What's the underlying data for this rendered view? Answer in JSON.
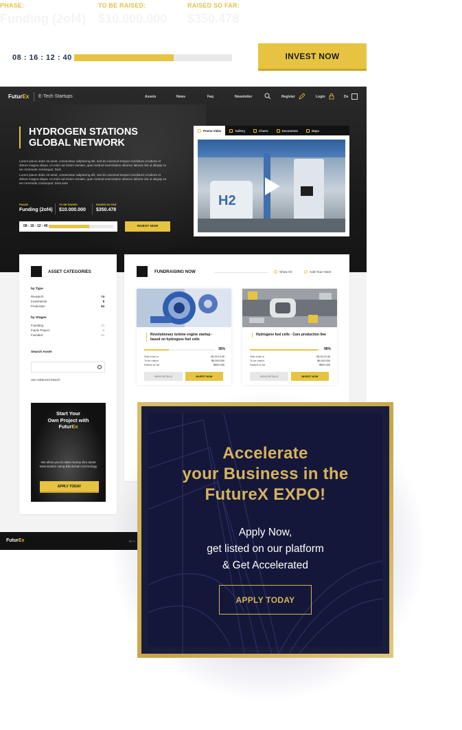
{
  "top": {
    "phase_label": "PHASE:",
    "to_be_raised_label": "TO BE RAISED:",
    "raised_so_far_label": "RAISED SO FAR:",
    "phase_value": "Funding (2of4)",
    "to_be_raised_value": "$10.000.000",
    "raised_value": "$350.478",
    "timer": "08 : 16 : 12 : 40",
    "progress": 0.63,
    "invest_label": "INVEST NOW"
  },
  "nav": {
    "logo_main": "Futur",
    "logo_accent": "Ex",
    "site_name": "E-Tech Startups",
    "items": [
      "Assets",
      "News",
      "Faq",
      "Newsletter"
    ],
    "register": "Register",
    "login": "Login",
    "lang": "De"
  },
  "hero": {
    "title": "HYDROGEN STATIONS GLOBAL NETWORK",
    "paragraph_1": "Lorem ipsum dolor sit amet, consectetur adipiscing elit, sed do eiusmod tempor incididunt ut labore et dolore magna aliqua. Ut enim ad minim veniam, quis nostrud exercitation ullamco laboris nisi ut aliquip ex ea commodo consequat. Duis",
    "paragraph_2": "Lorem ipsum dolor sit amet, consectetur adipiscing elit, sed do eiusmod tempor incididunt ut labore et dolore magna aliqua. Ut enim ad minim veniam, quis nostrud exercitation ullamco laboris nisi ut aliquip ex ea commodo consequat. Duis aute",
    "phase_label": "PHASE",
    "phase_value": "Funding (2of4)",
    "to_be_raised_label": "TO BE RAISED",
    "to_be_raised_value": "$10.000.000",
    "raised_label": "RAISED SO FAR",
    "raised_value": "$350.478",
    "timer": "08 : 16 : 12 : 40",
    "progress": 0.63,
    "invest_label": "INVEST NOW"
  },
  "media": {
    "tabs": [
      "Promo Video",
      "Gallery",
      "Charts",
      "Documents",
      "Maps"
    ],
    "tank_label": "H2"
  },
  "categories": {
    "title": "ASSET CATEGORIES",
    "by_type_label": "by Type",
    "by_type": [
      {
        "label": "Research",
        "count": "74"
      },
      {
        "label": "Investments",
        "count": "8"
      },
      {
        "label": "Production",
        "count": "64"
      }
    ],
    "by_stages_label": "by Stages",
    "by_stages": [
      {
        "label": "Founding",
        "count": "24"
      },
      {
        "label": "Future Project",
        "count": "9"
      },
      {
        "label": "Founded",
        "count": "64"
      }
    ],
    "search_label": "Search Asset",
    "search_placeholder": "",
    "advanced_search": "Use Advanced Search",
    "promo_line_1": "Start Your",
    "promo_line_2": "Own Project with",
    "promo_logo_main": "Futur",
    "promo_logo_accent": "Ex",
    "promo_text": "We allow you to raise money thru asset tokenization using Blockchain technology",
    "promo_button": "APPLY TODAY"
  },
  "fundraising": {
    "title": "FUNDRAISING NOW",
    "show_all": "Show All",
    "add_asset": "Add Your Asset",
    "projects": [
      {
        "title": "Revolutionary turbine engine startup - based on hydrogene fuel cells",
        "percent": "35%",
        "progress": 0.35,
        "rows": [
          {
            "k": "Sale ends in",
            "v": "05:15:12:40"
          },
          {
            "k": "To be raised",
            "v": "$5.000.000"
          },
          {
            "k": "Raised so far",
            "v": "$500.026"
          }
        ],
        "details": "VIEW DETAILS",
        "invest": "INVEST NOW"
      },
      {
        "title": "Hydrogene fuel cells - Cars production line",
        "percent": "96%",
        "progress": 0.96,
        "rows": [
          {
            "k": "Sale ends in",
            "v": "08:15:12:40"
          },
          {
            "k": "To be raised",
            "v": "$5.000.000"
          },
          {
            "k": "Raised so far",
            "v": "$500.026"
          }
        ],
        "details": "VIEW DETAILS",
        "invest": "INVEST NOW"
      }
    ]
  },
  "footer": {
    "logo_main": "Futur",
    "logo_accent": "Ex",
    "menu_fragment": "M’A"
  },
  "expo": {
    "heading_1": "Accelerate",
    "heading_2": "your Business in the",
    "heading_3": "FutureX EXPO!",
    "text_1": "Apply Now,",
    "text_2": "get listed on our platform",
    "text_3": "& Get Accelerated",
    "button": "APPLY TODAY"
  },
  "colors": {
    "accent": "#e6c441",
    "dark": "#121212",
    "navy": "#1a1c3c",
    "gold": "#d7b45a"
  }
}
